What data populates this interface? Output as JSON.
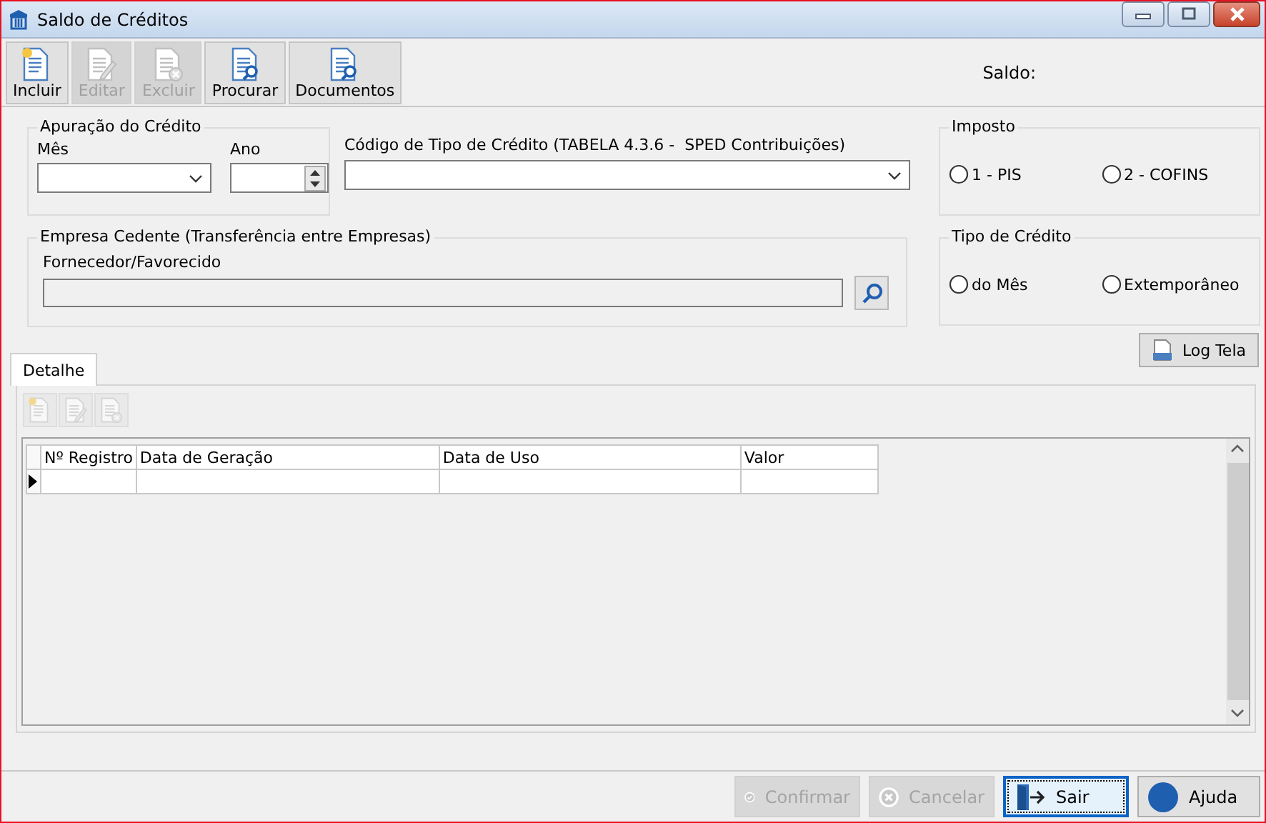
{
  "window": {
    "title": "Saldo de Créditos"
  },
  "toolbar": [
    {
      "kind": "new",
      "label": "Incluir",
      "disabled": false
    },
    {
      "kind": "edit",
      "label": "Editar",
      "disabled": true
    },
    {
      "kind": "delete",
      "label": "Excluir",
      "disabled": true
    },
    {
      "kind": "search",
      "label": "Procurar",
      "disabled": false
    },
    {
      "kind": "docs",
      "label": "Documentos",
      "disabled": false
    }
  ],
  "saldo": {
    "label": "Saldo:"
  },
  "apuracao": {
    "title": "Apuração do Crédito",
    "mes": {
      "label": "Mês"
    },
    "ano": {
      "label": "Ano"
    }
  },
  "codigo_tipo": {
    "label": "Código de Tipo de Crédito (TABELA 4.3.6 -  SPED Contribuições)"
  },
  "imposto": {
    "title": "Imposto",
    "options": [
      {
        "label": "1 - PIS",
        "selected": false
      },
      {
        "label": "2 - COFINS",
        "selected": false
      }
    ]
  },
  "empresa_cedente": {
    "title": "Empresa Cedente (Transferência entre Empresas)",
    "fornecedor": {
      "label": "Fornecedor/Favorecido"
    }
  },
  "tipo_credito": {
    "title": "Tipo de Crédito",
    "options": [
      {
        "label": "do Mês",
        "selected": false
      },
      {
        "label": "Extemporâneo",
        "selected": false
      }
    ]
  },
  "log_button": {
    "label": "Log Tela"
  },
  "tabs": [
    {
      "label": "Detalhe",
      "selected": true
    }
  ],
  "detail_toolbar": [
    {
      "kind": "add",
      "disabled": true
    },
    {
      "kind": "edit",
      "disabled": true
    },
    {
      "kind": "delete",
      "disabled": true
    }
  ],
  "grid": {
    "columns": [
      "Nº Registro",
      "Data de Geração",
      "Data de Uso",
      "Valor"
    ],
    "rows": [
      {
        "current": true
      }
    ]
  },
  "footer_buttons": [
    {
      "kind": "confirm",
      "label": "Confirmar",
      "disabled": true,
      "focused": false
    },
    {
      "kind": "cancel",
      "label": "Cancelar",
      "disabled": true,
      "focused": false
    },
    {
      "kind": "exit",
      "label": "Sair",
      "disabled": false,
      "focused": true
    },
    {
      "kind": "help",
      "label": "Ajuda",
      "disabled": false,
      "focused": false
    }
  ]
}
